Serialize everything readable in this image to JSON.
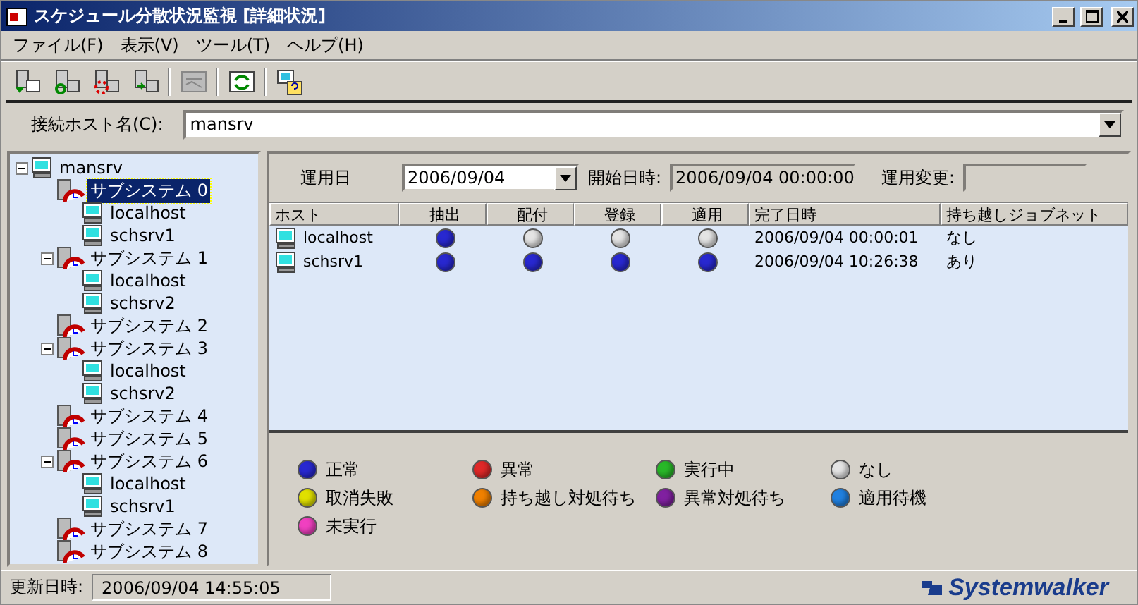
{
  "window": {
    "title": "スケジュール分散状況監視 [詳細状況]"
  },
  "menu": [
    "ファイル(F)",
    "表示(V)",
    "ツール(T)",
    "ヘルプ(H)"
  ],
  "host_field": {
    "label": "接続ホスト名(C):",
    "value": "mansrv"
  },
  "tree": [
    {
      "label": "mansrv",
      "kind": "server",
      "expanded": true,
      "selected": false,
      "children": [
        {
          "label": "サブシステム 0",
          "kind": "subsystem",
          "selected": true,
          "children": [
            {
              "label": "localhost",
              "kind": "host",
              "selected": false
            },
            {
              "label": "schsrv1",
              "kind": "host",
              "selected": false
            }
          ]
        },
        {
          "label": "サブシステム 1",
          "kind": "subsystem",
          "expanded": true,
          "selected": false,
          "children": [
            {
              "label": "localhost",
              "kind": "host",
              "selected": false
            },
            {
              "label": "schsrv2",
              "kind": "host",
              "selected": false
            }
          ]
        },
        {
          "label": "サブシステム 2",
          "kind": "subsystem",
          "selected": false
        },
        {
          "label": "サブシステム 3",
          "kind": "subsystem",
          "expanded": true,
          "selected": false,
          "children": [
            {
              "label": "localhost",
              "kind": "host",
              "selected": false
            },
            {
              "label": "schsrv2",
              "kind": "host",
              "selected": false
            }
          ]
        },
        {
          "label": "サブシステム 4",
          "kind": "subsystem",
          "selected": false
        },
        {
          "label": "サブシステム 5",
          "kind": "subsystem",
          "selected": false
        },
        {
          "label": "サブシステム 6",
          "kind": "subsystem",
          "expanded": true,
          "selected": false,
          "children": [
            {
              "label": "localhost",
              "kind": "host",
              "selected": false
            },
            {
              "label": "schsrv1",
              "kind": "host",
              "selected": false
            }
          ]
        },
        {
          "label": "サブシステム 7",
          "kind": "subsystem",
          "selected": false
        },
        {
          "label": "サブシステム 8",
          "kind": "subsystem",
          "selected": false
        }
      ]
    }
  ],
  "detail": {
    "date_label": "運用日",
    "date_value": "2006/09/04",
    "start_label": "開始日時:",
    "start_value": "2006/09/04 00:00:00",
    "change_label": "運用変更:"
  },
  "table": {
    "columns": [
      "ホスト",
      "抽出",
      "配付",
      "登録",
      "適用",
      "完了日時",
      "持ち越しジョブネット"
    ],
    "rows": [
      {
        "host": "localhost",
        "statuses": [
          {
            "color": "#2828d0"
          },
          {
            "color": "#e4e4e4"
          },
          {
            "color": "#e4e4e4"
          },
          {
            "color": "#e4e4e4"
          }
        ],
        "completed": "2006/09/04 00:00:01",
        "carryover": "なし"
      },
      {
        "host": "schsrv1",
        "statuses": [
          {
            "color": "#2828d0"
          },
          {
            "color": "#2828d0"
          },
          {
            "color": "#2828d0"
          },
          {
            "color": "#2828d0"
          }
        ],
        "completed": "2006/09/04 10:26:38",
        "carryover": "あり"
      }
    ]
  },
  "legend": [
    {
      "label": "正常",
      "color": "#2828d0"
    },
    {
      "label": "異常",
      "color": "#e02828"
    },
    {
      "label": "実行中",
      "color": "#28b828"
    },
    {
      "label": "なし",
      "color": "#e4e4e4"
    },
    {
      "label": "取消失敗",
      "color": "#e0e000"
    },
    {
      "label": "持ち越し対処待ち",
      "color": "#f08000"
    },
    {
      "label": "異常対処待ち",
      "color": "#8020a0"
    },
    {
      "label": "適用待機",
      "color": "#2080e0"
    },
    {
      "label": "未実行",
      "color": "#f040c0"
    }
  ],
  "status_bar": {
    "label": "更新日時:",
    "value": "2006/09/04 14:55:05"
  },
  "logo": "Systemwalker"
}
